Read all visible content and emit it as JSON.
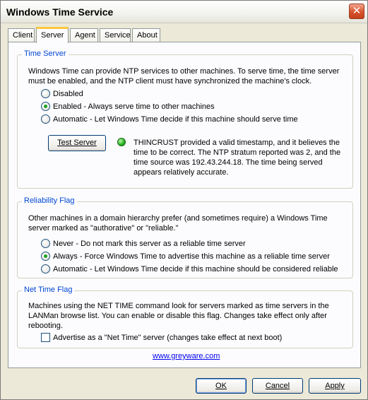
{
  "window": {
    "title": "Windows Time Service",
    "close_glyph": "✕"
  },
  "tabs": [
    {
      "label": "Client",
      "active": false
    },
    {
      "label": "Server",
      "active": true
    },
    {
      "label": "Agent",
      "active": false
    },
    {
      "label": "Service",
      "active": false
    },
    {
      "label": "About",
      "active": false
    }
  ],
  "time_server": {
    "title": "Time Server",
    "description_1": "Windows Time can provide NTP services to other machines. To serve time, the time server",
    "description_2": "must be enabled, and the NTP client must have synchronized the machine's clock.",
    "options": [
      {
        "label": "Disabled",
        "checked": false
      },
      {
        "label": "Enabled - Always serve time to other machines",
        "checked": true
      },
      {
        "label": "Automatic - Let Windows Time decide if this machine should serve time",
        "checked": false
      }
    ],
    "test_button": "Test Server",
    "status_color": "#23b01b",
    "status_lines": [
      "THINCRUST provided a valid timestamp, and it believes the",
      "time to be correct. The NTP stratum reported was 2, and the",
      "time source was 192.43.244.18. The time being served",
      "appears relatively accurate."
    ]
  },
  "reliability": {
    "title": "Reliability Flag",
    "description_1": "Other machines in a domain hierarchy prefer (and sometimes require) a Windows Time",
    "description_2": "server marked as \"authorative\" or \"reliable.\"",
    "options": [
      {
        "label": "Never - Do not mark this server as a reliable time server",
        "checked": false
      },
      {
        "label": "Always - Force Windows Time to advertise this machine as a reliable time server",
        "checked": true
      },
      {
        "label": "Automatic - Let Windows Time decide if this machine should be considered reliable",
        "checked": false
      }
    ]
  },
  "net_time": {
    "title": "Net Time Flag",
    "description_1": "Machines using the NET TIME command look for servers marked as time servers in the",
    "description_2": "LANMan browse list. You can enable or disable this flag. Changes take effect only after",
    "description_3": "rebooting.",
    "checkbox_label": "Advertise as a \"Net Time\" server (changes take effect at next boot)",
    "checked": false
  },
  "link": "www.greyware.com",
  "buttons": {
    "ok": "OK",
    "cancel": "Cancel",
    "apply": "Apply"
  },
  "colors": {
    "accent": "#0046D5",
    "tab_highlight": "#FFC83C",
    "face": "#ECE9D8"
  }
}
